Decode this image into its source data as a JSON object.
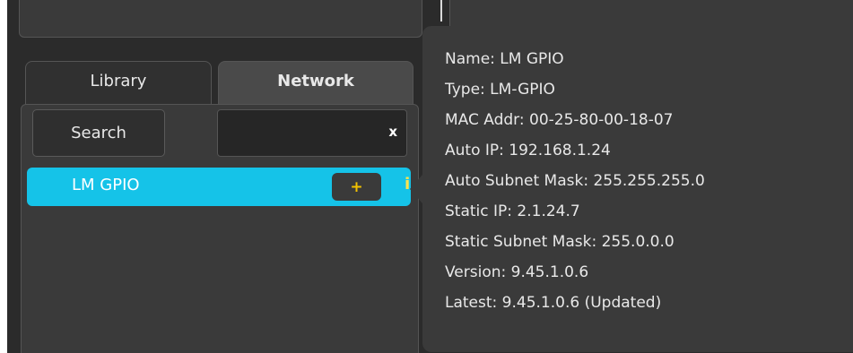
{
  "tabs": {
    "library": "Library",
    "network": "Network"
  },
  "search": {
    "button_label": "Search",
    "input_value": "",
    "clear_label": "x"
  },
  "device": {
    "name": "LM GPIO",
    "add_label": "+",
    "info_label": "i"
  },
  "tooltip": {
    "lines": [
      "Name: LM GPIO",
      "Type: LM-GPIO",
      "MAC Addr: 00-25-80-00-18-07",
      "Auto IP: 192.168.1.24",
      "Auto Subnet Mask: 255.255.255.0",
      "Static IP: 2.1.24.7",
      "Static Subnet Mask: 255.0.0.0",
      "Version: 9.45.1.0.6",
      "Latest: 9.45.1.0.6 (Updated)"
    ]
  },
  "colors": {
    "accent": "#15c3e8",
    "panel": "#3a3a3a",
    "plus": "#f2c200",
    "info": "#ffe34d"
  }
}
